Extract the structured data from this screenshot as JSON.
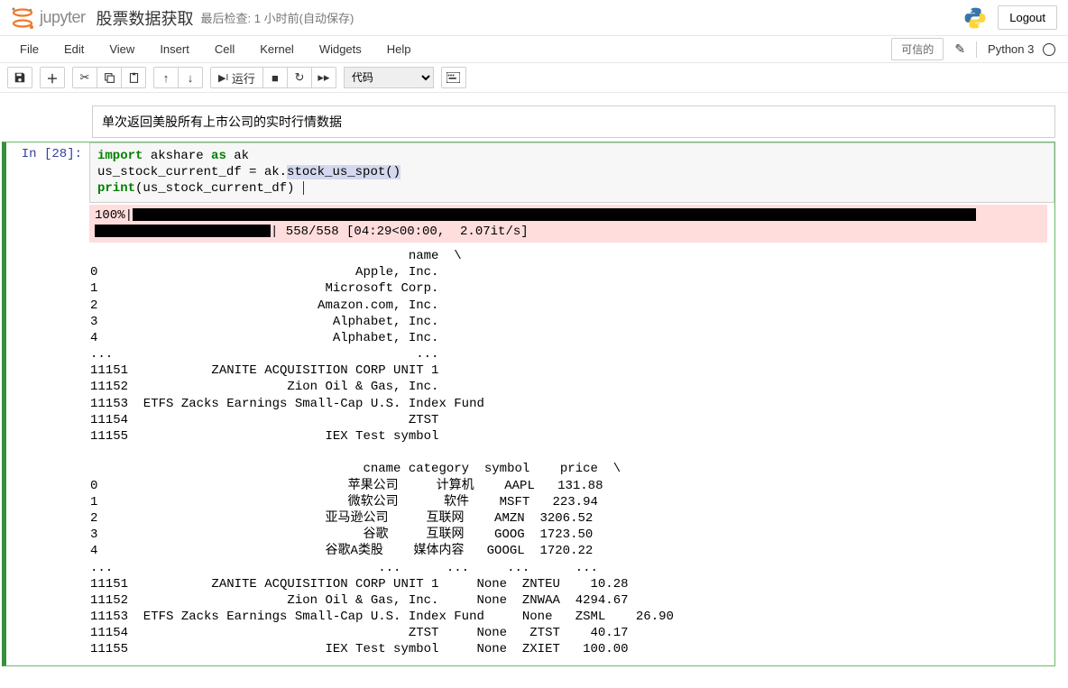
{
  "header": {
    "logo_text": "jupyter",
    "notebook_name": "股票数据获取",
    "last_checkpoint": "最后检查: 1 小时前",
    "autosave": "(自动保存)",
    "logout": "Logout"
  },
  "menubar": {
    "items": [
      "File",
      "Edit",
      "View",
      "Insert",
      "Cell",
      "Kernel",
      "Widgets",
      "Help"
    ],
    "trusted_label": "可信的",
    "kernel_name": "Python 3"
  },
  "toolbar": {
    "run_label": "运行",
    "celltype_selected": "代码"
  },
  "markdown_cell": {
    "text": "单次返回美股所有上市公司的实时行情数据"
  },
  "code_cell": {
    "prompt": "In  [28]:",
    "code": {
      "line1_import": "import",
      "line1_module": " akshare ",
      "line1_as": "as",
      "line1_alias": " ak",
      "line2_var": "us_stock_current_df = ak.",
      "line2_highlight": "stock_us_spot()",
      "line3_print": "print",
      "line3_rest": "(us_stock_current_df)"
    },
    "stderr_text": "100%|",
    "stderr_suffix": "| 558/558 [04:29<00:00,  2.07it/s]",
    "output_text": "                                          name  \\\n0                                  Apple, Inc.   \n1                              Microsoft Corp.   \n2                             Amazon.com, Inc.   \n3                               Alphabet, Inc.   \n4                               Alphabet, Inc.   \n...                                        ...   \n11151           ZANITE ACQUISITION CORP UNIT 1   \n11152                     Zion Oil & Gas, Inc.   \n11153  ETFS Zacks Earnings Small-Cap U.S. Index Fund   \n11154                                     ZTST   \n11155                          IEX Test symbol   \n\n                                    cname category  symbol    price  \\\n0                                 苹果公司     计算机    AAPL   131.88   \n1                                 微软公司      软件    MSFT   223.94   \n2                              亚马逊公司     互联网    AMZN  3206.52   \n3                                   谷歌     互联网    GOOG  1723.50   \n4                              谷歌A类股    媒体内容   GOOGL  1720.22   \n...                                   ...      ...     ...      ...   \n11151           ZANITE ACQUISITION CORP UNIT 1     None  ZNTEU    10.28   \n11152                     Zion Oil & Gas, Inc.     None  ZNWAA  4294.67   \n11153  ETFS Zacks Earnings Small-Cap U.S. Index Fund     None   ZSML    26.90   \n11154                                     ZTST     None   ZTST    40.17   \n11155                          IEX Test symbol     None  ZXIET   100.00   "
  }
}
